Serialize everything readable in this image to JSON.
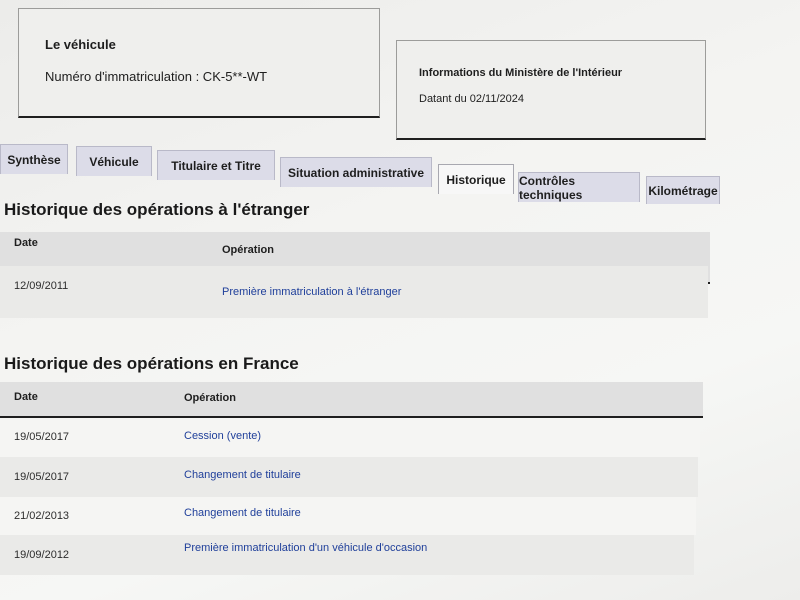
{
  "vehicle": {
    "title": "Le véhicule",
    "registration": "Numéro d'immatriculation : CK-5**-WT"
  },
  "ministry": {
    "title": "Informations du Ministère de l'Intérieur",
    "date": "Datant du 02/11/2024"
  },
  "tabs": [
    {
      "label": "Synthèse"
    },
    {
      "label": "Véhicule"
    },
    {
      "label": "Titulaire et Titre"
    },
    {
      "label": "Situation administrative"
    },
    {
      "label": "Historique"
    },
    {
      "label": "Contrôles techniques"
    },
    {
      "label": "Kilométrage"
    }
  ],
  "active_tab": "Historique",
  "foreign": {
    "title": "Historique des opérations à l'étranger",
    "headers": {
      "date": "Date",
      "operation": "Opération"
    },
    "rows": [
      {
        "date": "12/09/2011",
        "operation": "Première immatriculation à l'étranger"
      }
    ]
  },
  "france": {
    "title": "Historique des opérations en France",
    "headers": {
      "date": "Date",
      "operation": "Opération"
    },
    "rows": [
      {
        "date": "19/05/2017",
        "operation": "Cession (vente)"
      },
      {
        "date": "19/05/2017",
        "operation": "Changement de titulaire"
      },
      {
        "date": "21/02/2013",
        "operation": "Changement de titulaire"
      },
      {
        "date": "19/09/2012",
        "operation": "Première immatriculation d'un véhicule d'occasion"
      }
    ]
  }
}
